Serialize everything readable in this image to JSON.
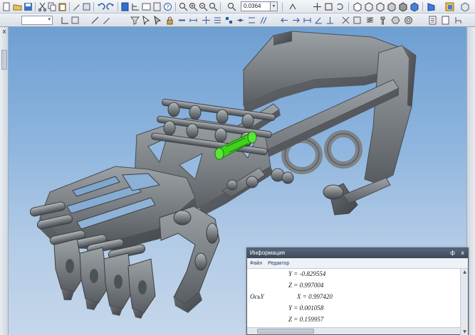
{
  "toolbar": {
    "zoom_value": "0.0364",
    "zoom_dropdown_arrow": "▾"
  },
  "side": {
    "close_glyph": "x"
  },
  "viewport": {
    "model_name": "robotic-hand-assembly",
    "selected_part_color": "#3fd11e"
  },
  "info_panel": {
    "title": "Информация",
    "pin_glyph": "ф",
    "close_glyph": "x",
    "menu": [
      {
        "label": "Файл"
      },
      {
        "label": "Редактор"
      }
    ],
    "lines": [
      {
        "label": "",
        "value": "Y = -0.829554"
      },
      {
        "label": "",
        "value": "Z = 0.997004"
      },
      {
        "label": "ОсьY",
        "value": "X = 0.997420"
      },
      {
        "label": "",
        "value": "Y = 0.001058"
      },
      {
        "label": "",
        "value": "Z = 0.159957"
      }
    ]
  },
  "colors": {
    "metal": "#7d8287",
    "metal_dark": "#4b5055",
    "selection": "#3fd11e",
    "background_top": "#6e9fd2",
    "background_bottom": "#c6d7ea"
  }
}
